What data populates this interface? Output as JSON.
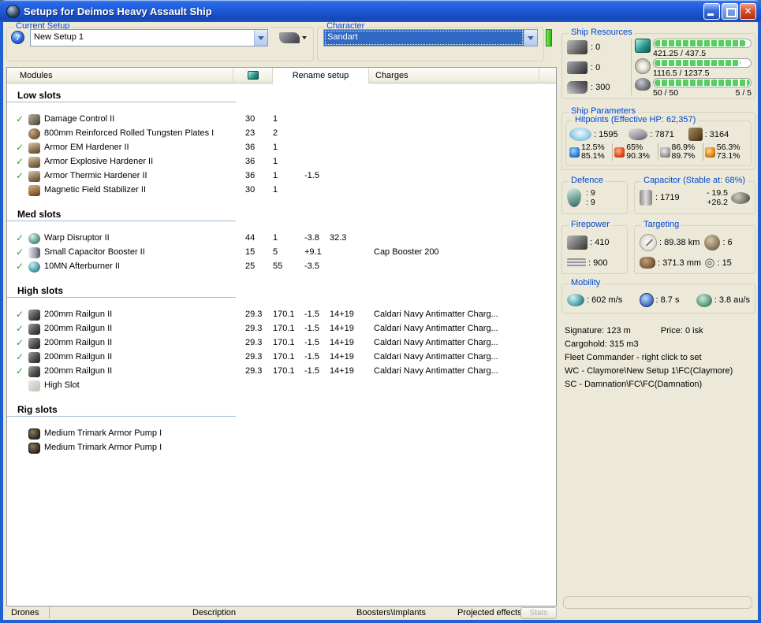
{
  "window": {
    "title": "Setups for Deimos Heavy Assault Ship"
  },
  "toolbar": {
    "current_setup_label": "Current Setup",
    "current_setup_value": "New Setup 1",
    "character_label": "Character",
    "character_value": "Sandart"
  },
  "tabs": {
    "modules": "Modules",
    "rename_setup": "Rename setup",
    "charges": "Charges"
  },
  "slots": {
    "groups": [
      {
        "name": "Low slots",
        "rows": [
          {
            "check": true,
            "icon": "damage-control-icon",
            "cls": "mi-dc",
            "name": "Damage Control II",
            "c1": "30",
            "c2": "1",
            "c3": "",
            "c4": "",
            "charge": ""
          },
          {
            "check": false,
            "icon": "armor-plate-icon",
            "cls": "mi-plate",
            "name": "800mm Reinforced Rolled Tungsten Plates I",
            "c1": "23",
            "c2": "2",
            "c3": "",
            "c4": "",
            "charge": ""
          },
          {
            "check": true,
            "icon": "armor-hardener-icon",
            "cls": "mi-hard",
            "name": "Armor EM Hardener II",
            "c1": "36",
            "c2": "1",
            "c3": "",
            "c4": "",
            "charge": ""
          },
          {
            "check": true,
            "icon": "armor-hardener-icon",
            "cls": "mi-hard",
            "name": "Armor Explosive Hardener II",
            "c1": "36",
            "c2": "1",
            "c3": "",
            "c4": "",
            "charge": ""
          },
          {
            "check": true,
            "icon": "armor-hardener-icon",
            "cls": "mi-hard",
            "name": "Armor Thermic Hardener II",
            "c1": "36",
            "c2": "1",
            "c3": "-1.5",
            "c4": "",
            "charge": ""
          },
          {
            "check": false,
            "icon": "mag-stab-icon",
            "cls": "mi-mag",
            "name": "Magnetic Field Stabilizer II",
            "c1": "30",
            "c2": "1",
            "c3": "",
            "c4": "",
            "charge": ""
          }
        ]
      },
      {
        "name": "Med slots",
        "rows": [
          {
            "check": true,
            "icon": "warp-disruptor-icon",
            "cls": "mi-wd",
            "name": "Warp Disruptor II",
            "c1": "44",
            "c2": "1",
            "c3": "-3.8",
            "c4": "32.3",
            "charge": ""
          },
          {
            "check": true,
            "icon": "cap-booster-icon",
            "cls": "mi-cb",
            "name": "Small Capacitor Booster II",
            "c1": "15",
            "c2": "5",
            "c3": "+9.1",
            "c4": "",
            "charge": "Cap Booster 200"
          },
          {
            "check": true,
            "icon": "afterburner-icon",
            "cls": "mi-ab",
            "name": "10MN Afterburner II",
            "c1": "25",
            "c2": "55",
            "c3": "-3.5",
            "c4": "",
            "charge": ""
          }
        ]
      },
      {
        "name": "High slots",
        "rows": [
          {
            "check": true,
            "icon": "railgun-icon",
            "cls": "mi-rail",
            "name": "200mm Railgun II",
            "c1": "29.3",
            "c2": "170.1",
            "c3": "-1.5",
            "c4": "14+19",
            "charge": "Caldari Navy Antimatter Charg..."
          },
          {
            "check": true,
            "icon": "railgun-icon",
            "cls": "mi-rail",
            "name": "200mm Railgun II",
            "c1": "29.3",
            "c2": "170.1",
            "c3": "-1.5",
            "c4": "14+19",
            "charge": "Caldari Navy Antimatter Charg..."
          },
          {
            "check": true,
            "icon": "railgun-icon",
            "cls": "mi-rail",
            "name": "200mm Railgun II",
            "c1": "29.3",
            "c2": "170.1",
            "c3": "-1.5",
            "c4": "14+19",
            "charge": "Caldari Navy Antimatter Charg..."
          },
          {
            "check": true,
            "icon": "railgun-icon",
            "cls": "mi-rail",
            "name": "200mm Railgun II",
            "c1": "29.3",
            "c2": "170.1",
            "c3": "-1.5",
            "c4": "14+19",
            "charge": "Caldari Navy Antimatter Charg..."
          },
          {
            "check": true,
            "icon": "railgun-icon",
            "cls": "mi-rail",
            "name": "200mm Railgun II",
            "c1": "29.3",
            "c2": "170.1",
            "c3": "-1.5",
            "c4": "14+19",
            "charge": "Caldari Navy Antimatter Charg..."
          },
          {
            "check": false,
            "icon": "empty-highslot-icon",
            "cls": "mi-empty",
            "name": "High Slot",
            "c1": "",
            "c2": "",
            "c3": "",
            "c4": "",
            "charge": ""
          }
        ]
      },
      {
        "name": "Rig slots",
        "rows": [
          {
            "check": false,
            "icon": "rig-icon",
            "cls": "mi-rig",
            "name": "Medium Trimark Armor Pump I",
            "c1": "",
            "c2": "",
            "c3": "",
            "c4": "",
            "charge": ""
          },
          {
            "check": false,
            "icon": "rig-icon",
            "cls": "mi-rig",
            "name": "Medium Trimark Armor Pump I",
            "c1": "",
            "c2": "",
            "c3": "",
            "c4": "",
            "charge": ""
          }
        ]
      }
    ]
  },
  "resources": {
    "label": "Ship Resources",
    "turrets": ": 0",
    "launchers": ": 0",
    "calibration": ": 300",
    "cpu": {
      "text": "421.25 / 437.5",
      "pct": 96
    },
    "powergrid": {
      "text": "1116.5 / 1237.5",
      "pct": 90
    },
    "drones": {
      "text": "50 / 50",
      "right": "5 / 5",
      "pct": 100
    }
  },
  "parameters": {
    "label": "Ship Parameters",
    "hitpoints": {
      "label": "Hitpoints (Effective HP: 62,357)",
      "shield": ": 1595",
      "armor": ": 7871",
      "structure": ": 3164",
      "resists": [
        {
          "icon": "em-resist-icon",
          "cls": "r-em",
          "top": "12.5%",
          "bottom": "85.1%"
        },
        {
          "icon": "thermal-resist-icon",
          "cls": "r-th",
          "top": "65%",
          "bottom": "90.3%"
        },
        {
          "icon": "kinetic-resist-icon",
          "cls": "r-ki",
          "top": "86.9%",
          "bottom": "89.7%"
        },
        {
          "icon": "explosive-resist-icon",
          "cls": "r-ex",
          "top": "56.3%",
          "bottom": "73.1%"
        }
      ]
    }
  },
  "defence": {
    "label": "Defence",
    "v1": ": 9",
    "v2": ": 9"
  },
  "capacitor": {
    "label": "Capacitor (Stable at: 68%)",
    "amount": ": 1719",
    "minus": "- 19.5",
    "plus": "+26.2"
  },
  "firepower": {
    "label": "Firepower",
    "turret": ": 410",
    "missile": ": 900"
  },
  "targeting": {
    "label": "Targeting",
    "range": ": 89.38 km",
    "sensors": ": 6",
    "resolution": ": 371.3 mm",
    "locks": ": 15"
  },
  "mobility": {
    "label": "Mobility",
    "speed": ": 602 m/s",
    "align": ": 8.7 s",
    "warp": ": 3.8 au/s"
  },
  "info": {
    "signature": "Signature: 123 m",
    "price": "Price: 0 isk",
    "cargohold": "Cargohold: 315 m3",
    "fleet": "Fleet Commander - right click to set",
    "wc": "WC - Claymore\\New Setup 1\\FC(Claymore)",
    "sc": "SC - Damnation\\FC\\FC(Damnation)"
  },
  "bottom": {
    "tabs": [
      "Drones",
      "Description",
      "Boosters\\Implants",
      "Projected effects"
    ],
    "stats_label": "Stats"
  },
  "colors": {
    "caption_blue": "#0046D5",
    "check_green": "#2EA12E",
    "bar_green": "#55D05C",
    "selection_blue": "#316AC5"
  }
}
